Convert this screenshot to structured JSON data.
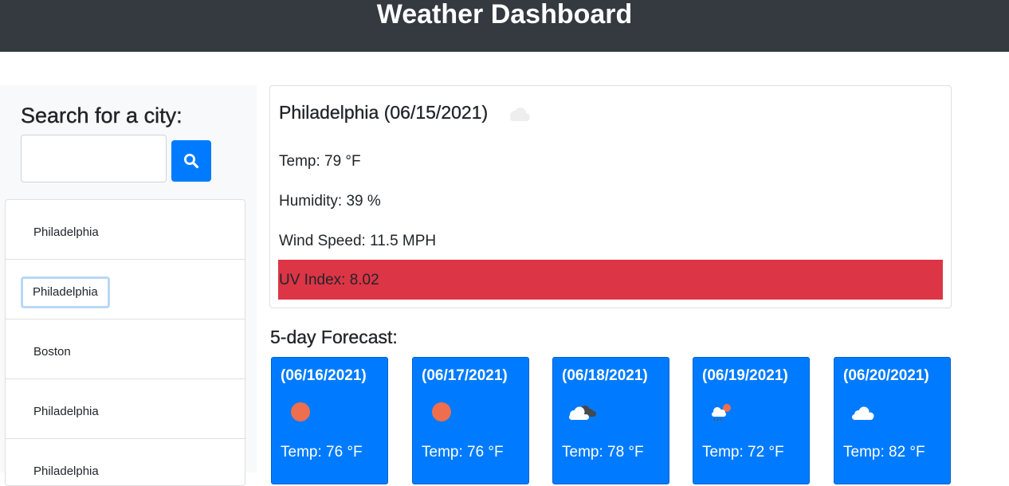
{
  "header": {
    "title": "Weather Dashboard"
  },
  "sidebar": {
    "search_heading": "Search for a city:",
    "search_value": "",
    "search_icon": "search-icon",
    "history": [
      {
        "label": "Philadelphia",
        "focused": false
      },
      {
        "label": "Philadelphia",
        "focused": true
      },
      {
        "label": "Boston",
        "focused": false
      },
      {
        "label": "Philadelphia",
        "focused": false
      },
      {
        "label": "Philadelphia",
        "focused": false
      }
    ]
  },
  "current": {
    "title": "Philadelphia (06/15/2021)",
    "icon": "cloud-icon",
    "temp": "Temp: 79 °F",
    "humidity": "Humidity: 39 %",
    "wind": "Wind Speed: 11.5 MPH",
    "uv": "UV Index: 8.02",
    "uv_color": "#dc3545"
  },
  "forecast": {
    "title": "5-day Forecast:",
    "days": [
      {
        "date": "(06/16/2021)",
        "icon": "sun-icon",
        "temp": "Temp: 76 °F"
      },
      {
        "date": "(06/17/2021)",
        "icon": "sun-icon",
        "temp": "Temp: 76 °F"
      },
      {
        "date": "(06/18/2021)",
        "icon": "broken-clouds-icon",
        "temp": "Temp: 78 °F"
      },
      {
        "date": "(06/19/2021)",
        "icon": "rain-sun-icon",
        "temp": "Temp: 72 °F"
      },
      {
        "date": "(06/20/2021)",
        "icon": "cloud-icon",
        "temp": "Temp: 82 °F"
      }
    ]
  },
  "colors": {
    "header_bg": "#343a40",
    "accent": "#007bff",
    "sidebar_bg": "#f8f9fa",
    "sun": "#ee6e4e"
  }
}
